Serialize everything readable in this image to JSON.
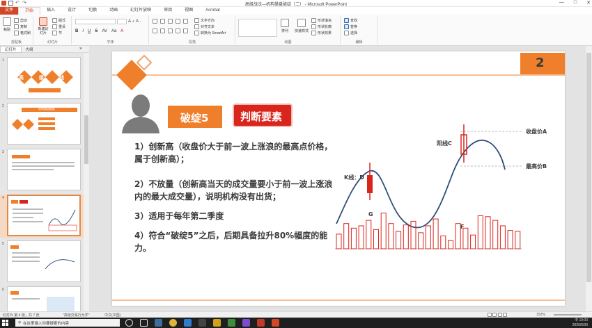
{
  "window": {
    "title": "高级战法—机构操盘破绽（二） - Microsoft PowerPoint",
    "minimize": "—",
    "restore": "□",
    "close": "✕"
  },
  "tabs": [
    "文件",
    "开始",
    "插入",
    "设计",
    "切换",
    "动画",
    "幻灯片放映",
    "审阅",
    "视图",
    "Acrobat"
  ],
  "ribbon": {
    "groups": {
      "clipboard": "剪贴板",
      "slides": "幻灯片",
      "font": "字体",
      "paragraph": "段落",
      "drawing": "绘图",
      "editing": "编辑"
    },
    "clipboard": {
      "paste": "粘贴",
      "cut": "剪切",
      "copy": "复制",
      "format_painter": "格式刷"
    },
    "slides": {
      "new_slide": "新建幻灯片",
      "layout": "版式",
      "reset": "重设",
      "section": "节"
    },
    "paragraph": {
      "text_direction": "文字方向",
      "align_text": "对齐文本",
      "smartart": "转换为 SmartArt"
    },
    "drawing": {
      "arrange": "排列",
      "quick_styles": "快速样式",
      "fill": "形状填充",
      "outline": "形状轮廓",
      "effects": "形状效果"
    },
    "editing": {
      "find": "查找",
      "replace": "替换",
      "select": "选择"
    }
  },
  "pane": {
    "tab_slides": "幻灯片",
    "tab_outline": "大纲",
    "close": "×"
  },
  "thumbnails": [
    {
      "num": "1",
      "title": "高 级 战 法"
    },
    {
      "num": "2",
      "title": "机构操盘破绽"
    },
    {
      "num": "3",
      "title": ""
    },
    {
      "num": "4",
      "title": ""
    },
    {
      "num": "5",
      "title": ""
    },
    {
      "num": "6",
      "title": ""
    }
  ],
  "slide": {
    "page_number": "2",
    "badge1": "破绽5",
    "badge2": "判断要素",
    "points": [
      "1）创新高（收盘价大于前一波上涨浪的最高点价格，属于创新高）；",
      "2）不放量（创新高当天的成交量要小于前一波上涨浪内的最大成交量），说明机构没有出货；",
      "3）适用于每年第二季度",
      "4）符合“破绽5”之后，后期具备拉升80%幅度的能力。"
    ],
    "chart_labels": {
      "close_price": "收盘价A",
      "high_price": "最高价B",
      "yang_c": "阳线C",
      "k_line_d": "K线：D",
      "g": "G",
      "f": "F"
    },
    "volume_bars": [
      0.32,
      0.55,
      0.45,
      0.5,
      0.62,
      0.42,
      0.78,
      0.55,
      0.38,
      0.52,
      0.6,
      0.35,
      0.5,
      0.65,
      0.28,
      0.18,
      0.55,
      0.45,
      0.3,
      0.72,
      0.7,
      0.62,
      0.5,
      0.4,
      0.38
    ]
  },
  "status": {
    "slide_info": "幻灯片 第 4 张，共 7 张",
    "theme": "\"高级交易行为学\"",
    "language": "中文(中国)",
    "zoom": "152%"
  },
  "taskbar": {
    "search_placeholder": "在这里输入你要搜索的内容",
    "time": "10:03",
    "date": "2020/6/30",
    "ime": "中"
  }
}
